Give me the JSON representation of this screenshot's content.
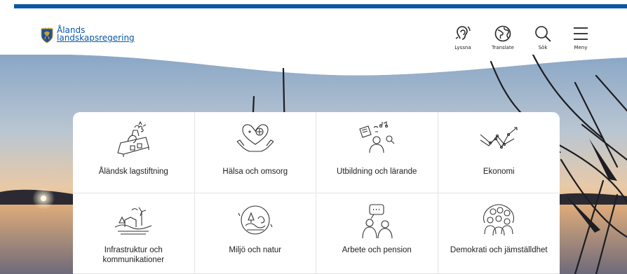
{
  "brand": {
    "line1": "Ålands",
    "line2": "landskapsregering"
  },
  "toolbar": {
    "listen_label": "Lyssna",
    "translate_label": "Translate",
    "search_label": "Sök",
    "menu_label": "Meny"
  },
  "categories": [
    {
      "label": "Åländsk lagstiftning",
      "icon": "parliament-icon"
    },
    {
      "label": "Hälsa och omsorg",
      "icon": "health-heart-icon"
    },
    {
      "label": "Utbildning och lärande",
      "icon": "education-icon"
    },
    {
      "label": "Ekonomi",
      "icon": "economy-chart-icon"
    },
    {
      "label": "Infrastruktur och kommunikationer",
      "icon": "infrastructure-icon"
    },
    {
      "label": "Miljö och natur",
      "icon": "nature-icon"
    },
    {
      "label": "Arbete och pension",
      "icon": "work-icon"
    },
    {
      "label": "Demokrati och jämställdhet",
      "icon": "democracy-icon"
    }
  ],
  "colors": {
    "brand_blue": "#0b57a4"
  }
}
